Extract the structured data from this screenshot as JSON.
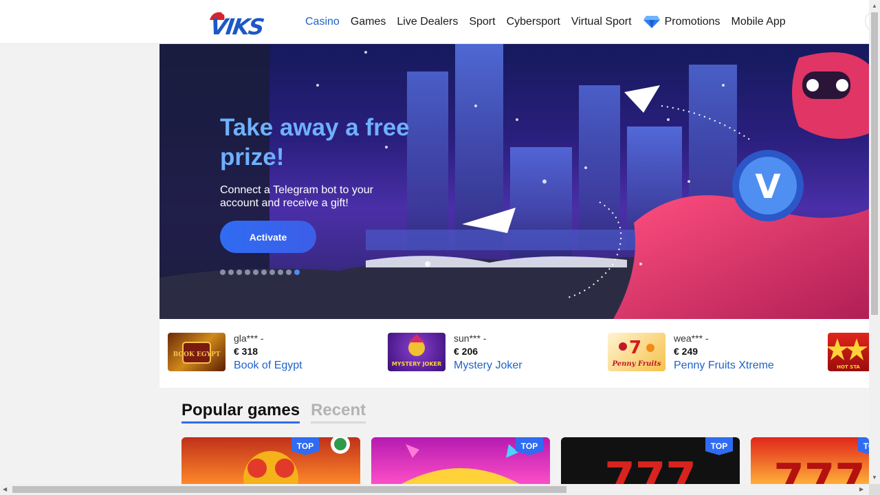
{
  "logo": {
    "text": "VIKS"
  },
  "nav": {
    "items": [
      {
        "label": "Casino",
        "active": true
      },
      {
        "label": "Games"
      },
      {
        "label": "Live Dealers"
      },
      {
        "label": "Sport"
      },
      {
        "label": "Cybersport"
      },
      {
        "label": "Virtual Sport"
      },
      {
        "label": "Promotions",
        "icon": "diamond-icon"
      },
      {
        "label": "Mobile App"
      }
    ]
  },
  "banner": {
    "title": "Take away a free prize!",
    "text": "Connect a Telegram bot to your account and receive a gift!",
    "button": "Activate",
    "slide_count": 10,
    "active_slide": 10,
    "emblem_letter": "V"
  },
  "winners": [
    {
      "user": "gla*** -",
      "amount": "€ 318",
      "game": "Book of Egypt",
      "thumb_label": "BOOK EGYPT"
    },
    {
      "user": "sun*** -",
      "amount": "€ 206",
      "game": "Mystery Joker",
      "thumb_label": "MYSTERY JOKER"
    },
    {
      "user": "wea*** -",
      "amount": "€ 249",
      "game": "Penny Fruits Xtreme",
      "thumb_label": "Penny Fruits"
    },
    {
      "user": "",
      "amount": "",
      "game": "",
      "thumb_label": "HOT STA"
    }
  ],
  "games": {
    "tabs": [
      {
        "label": "Popular games",
        "active": true
      },
      {
        "label": "Recent",
        "active": false
      }
    ],
    "badge": "TOP",
    "cards": [
      {
        "name": "game-card-1",
        "badge": true
      },
      {
        "name": "game-card-2",
        "badge": true
      },
      {
        "name": "game-card-3",
        "badge": true
      },
      {
        "name": "game-card-4",
        "badge": true
      }
    ]
  },
  "colors": {
    "accent": "#2f6cf2",
    "link": "#1e62c8",
    "title_blue": "#6fb0ff"
  }
}
